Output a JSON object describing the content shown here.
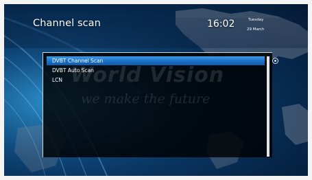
{
  "header": {
    "title": "Channel scan",
    "time": "16:02",
    "day": "Tuesday",
    "date": "29 March"
  },
  "watermark": {
    "brand": "World Vision",
    "slogan": "we make the future"
  },
  "menu": {
    "items": [
      {
        "label": "DVBT Channel Scan",
        "selected": true
      },
      {
        "label": "DVBT Auto Scan",
        "selected": false
      },
      {
        "label": "LCN",
        "selected": false
      }
    ]
  },
  "colors": {
    "selection": "#1a6fc4",
    "panel": "#000000",
    "text": "#ffffff"
  }
}
